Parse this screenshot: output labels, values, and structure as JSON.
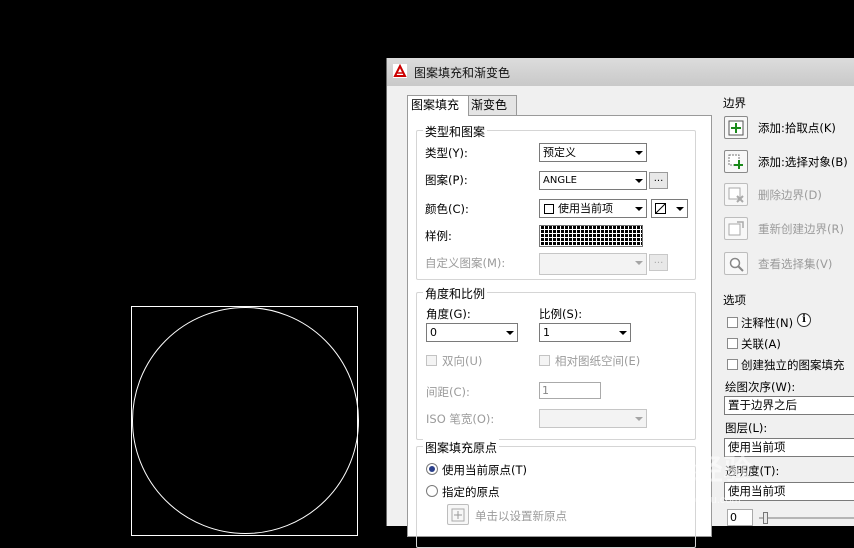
{
  "dialog": {
    "title": "图案填充和渐变色",
    "tabs": [
      "图案填充",
      "渐变色"
    ]
  },
  "type_pattern": {
    "group_title": "类型和图案",
    "type_label": "类型(Y):",
    "type_value": "预定义",
    "pattern_label": "图案(P):",
    "pattern_value": "ANGLE",
    "color_label": "颜色(C):",
    "color_value": "使用当前项",
    "sample_label": "样例:",
    "custom_label": "自定义图案(M):",
    "ellipsis": "..."
  },
  "angle_scale": {
    "group_title": "角度和比例",
    "angle_label": "角度(G):",
    "angle_value": "0",
    "scale_label": "比例(S):",
    "scale_value": "1",
    "double_label": "双向(U)",
    "relative_label": "相对图纸空间(E)",
    "spacing_label": "间距(C):",
    "spacing_value": "1",
    "iso_label": "ISO 笔宽(O):"
  },
  "origin": {
    "group_title": "图案填充原点",
    "use_current": "使用当前原点(T)",
    "specified": "指定的原点",
    "click_set": "单击以设置新原点"
  },
  "boundaries": {
    "title": "边界",
    "add_pick": "添加:拾取点(K)",
    "add_select": "添加:选择对象(B)",
    "remove": "删除边界(D)",
    "recreate": "重新创建边界(R)",
    "view": "查看选择集(V)"
  },
  "options": {
    "title": "选项",
    "annotative": "注释性(N)",
    "associative": "关联(A)",
    "separate": "创建独立的图案填充",
    "draw_order_label": "绘图次序(W):",
    "draw_order_value": "置于边界之后",
    "layer_label": "图层(L):",
    "layer_value": "使用当前项",
    "transparency_label": "透明度(T):",
    "transparency_value": "使用当前项",
    "transparency_number": "0"
  },
  "watermark": {
    "text": "Bai经验",
    "sub": "jingyan.baidu.com"
  }
}
